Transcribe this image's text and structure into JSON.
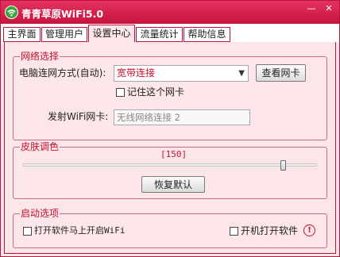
{
  "window": {
    "title": "青青草原WiFi5.0",
    "minimize_glyph": "—",
    "close_glyph": "✕",
    "accent_color": "#d21f4b",
    "panel_color": "#fce6ea"
  },
  "tabs": [
    {
      "label": "主界面",
      "active": false
    },
    {
      "label": "管理用户",
      "active": false
    },
    {
      "label": "设置中心",
      "active": true
    },
    {
      "label": "流量统计",
      "active": false
    },
    {
      "label": "帮助信息",
      "active": false
    }
  ],
  "network": {
    "legend": "网络选择",
    "adapter_label": "电脑连网方式(自动):",
    "adapter_value": "宽带连接",
    "view_button": "查看网卡",
    "remember_label": "记住这个网卡",
    "remember_checked": false,
    "transmit_label": "发射WiFi网卡:",
    "transmit_value": "无线网络连接 2"
  },
  "skin": {
    "legend": "皮肤调色",
    "value_text": "[150]",
    "slider_fraction": 0.885,
    "reset_button": "恢复默认"
  },
  "startup": {
    "legend": "启动选项",
    "autostart_wifi_label": "打开软件马上开启WiFi",
    "autostart_wifi_checked": false,
    "boot_open_label": "开机打开软件",
    "boot_open_checked": false,
    "info_glyph": "!"
  },
  "icons": {
    "app": "wifi-icon",
    "warning": "exclamation-icon"
  }
}
